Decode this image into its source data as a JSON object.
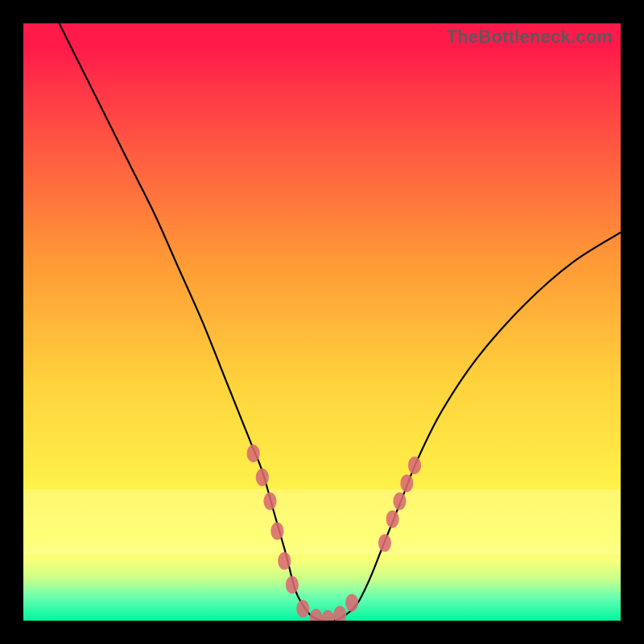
{
  "watermark": "TheBottleneck.com",
  "chart_data": {
    "type": "line",
    "title": "",
    "xlabel": "",
    "ylabel": "",
    "xlim": [
      0,
      100
    ],
    "ylim": [
      0,
      100
    ],
    "series": [
      {
        "name": "curve",
        "x": [
          6,
          10,
          14,
          18,
          22,
          26,
          30,
          34,
          38,
          40,
          42,
          44,
          45,
          46,
          48,
          50,
          52,
          54,
          56,
          58,
          60,
          62,
          64,
          66,
          70,
          76,
          84,
          92,
          100
        ],
        "y": [
          100,
          92,
          84,
          76,
          68,
          59,
          50,
          40,
          30,
          25,
          18,
          11,
          7,
          4,
          1,
          0,
          0,
          1,
          3,
          7,
          12,
          17,
          22,
          27,
          35,
          44,
          53,
          60,
          65
        ]
      }
    ],
    "markers": {
      "name": "highlight-points",
      "color": "#d96a72",
      "points": [
        {
          "x": 38.5,
          "y": 28
        },
        {
          "x": 40.0,
          "y": 24
        },
        {
          "x": 41.3,
          "y": 20
        },
        {
          "x": 42.5,
          "y": 15
        },
        {
          "x": 43.7,
          "y": 10
        },
        {
          "x": 45.0,
          "y": 6
        },
        {
          "x": 46.8,
          "y": 2
        },
        {
          "x": 49.0,
          "y": 0.5
        },
        {
          "x": 51.0,
          "y": 0.3
        },
        {
          "x": 53.0,
          "y": 1
        },
        {
          "x": 55.0,
          "y": 3
        },
        {
          "x": 60.5,
          "y": 13
        },
        {
          "x": 61.8,
          "y": 17
        },
        {
          "x": 63.0,
          "y": 20
        },
        {
          "x": 64.2,
          "y": 23
        },
        {
          "x": 65.5,
          "y": 26
        }
      ]
    },
    "background_gradient": {
      "stops": [
        {
          "pos": 0.0,
          "color": "#ff1a4a"
        },
        {
          "pos": 0.6,
          "color": "#ffd23c"
        },
        {
          "pos": 0.86,
          "color": "#ffff58"
        },
        {
          "pos": 1.0,
          "color": "#00f5a0"
        }
      ]
    }
  }
}
